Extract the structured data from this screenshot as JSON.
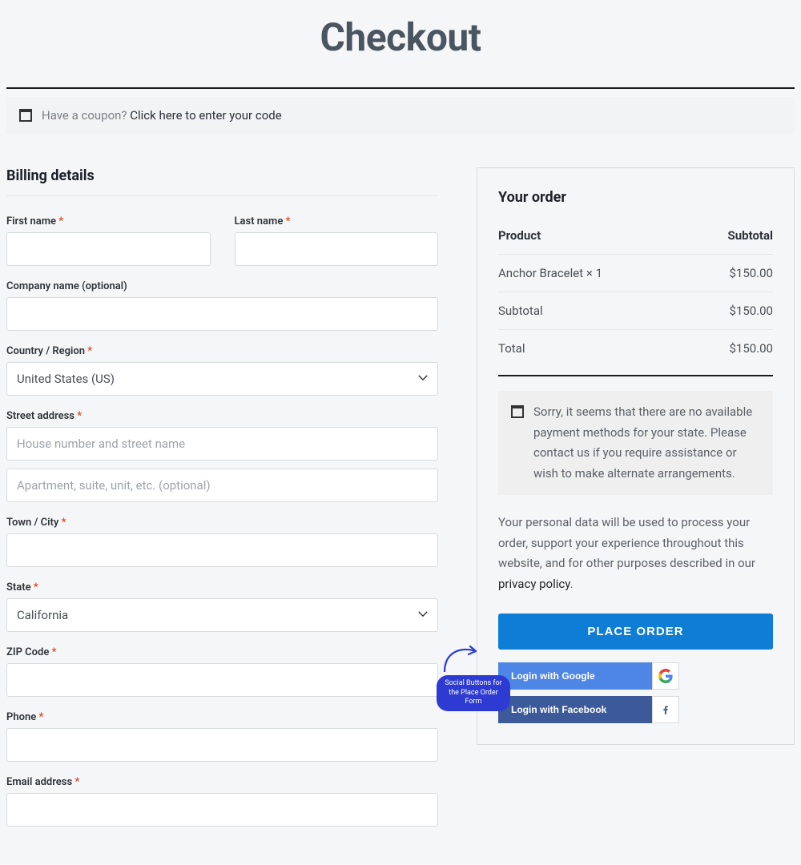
{
  "page": {
    "title": "Checkout"
  },
  "coupon": {
    "prompt": "Have a coupon? ",
    "link": "Click here to enter your code"
  },
  "billing": {
    "heading": "Billing details",
    "first_name": {
      "label": "First name"
    },
    "last_name": {
      "label": "Last name"
    },
    "company": {
      "label": "Company name (optional)"
    },
    "country": {
      "label": "Country / Region",
      "value": "United States (US)"
    },
    "street": {
      "label": "Street address",
      "placeholder1": "House number and street name",
      "placeholder2": "Apartment, suite, unit, etc. (optional)"
    },
    "city": {
      "label": "Town / City"
    },
    "state": {
      "label": "State",
      "value": "California"
    },
    "zip": {
      "label": "ZIP Code"
    },
    "phone": {
      "label": "Phone"
    },
    "email": {
      "label": "Email address"
    }
  },
  "order": {
    "heading": "Your order",
    "head_product": "Product",
    "head_subtotal": "Subtotal",
    "items": [
      {
        "name": "Anchor Bracelet × 1",
        "subtotal": "$150.00"
      }
    ],
    "subtotal_label": "Subtotal",
    "subtotal_value": "$150.00",
    "total_label": "Total",
    "total_value": "$150.00",
    "payment_notice": "Sorry, it seems that there are no available payment methods for your state. Please contact us if you require assistance or wish to make alternate arrangements.",
    "privacy_text": "Your personal data will be used to process your order, support your experience throughout this website, and for other purposes described in our ",
    "privacy_link": "privacy policy",
    "place_order": "PLACE ORDER",
    "google_label": "Login with Google",
    "facebook_label": "Login with Facebook"
  },
  "annotation": {
    "line1": "Social Buttons for",
    "line2": "the Place Order Form"
  },
  "required_mark": "*"
}
